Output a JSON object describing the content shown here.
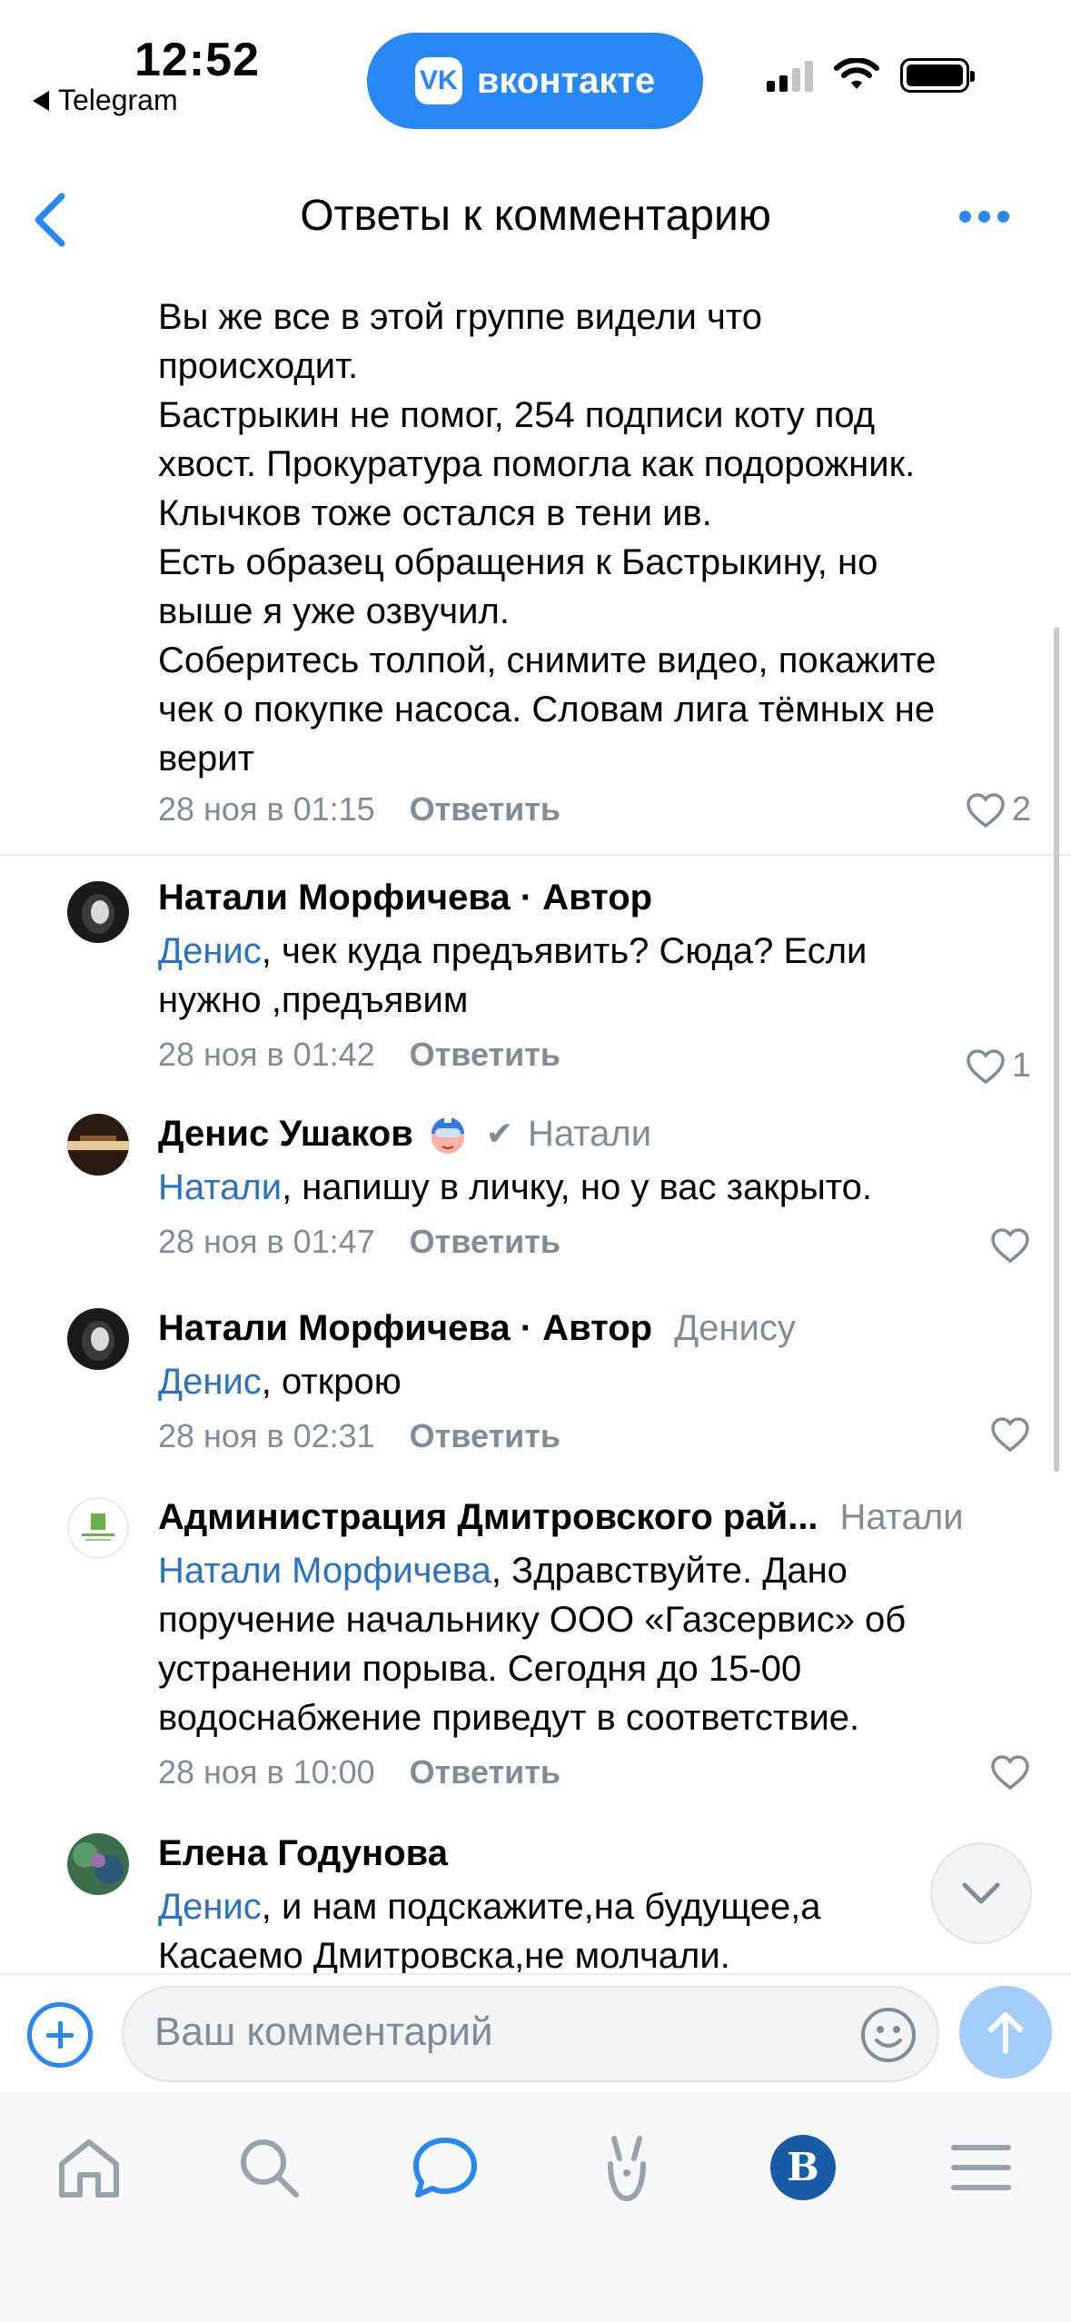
{
  "status_bar": {
    "time": "12:52",
    "back_app": "Telegram",
    "center_pill": "вконтакте",
    "vk_logo": "VK"
  },
  "header": {
    "title": "Ответы к комментарию",
    "back_icon": "chevron-left-icon",
    "more_icon": "more-horizontal-icon"
  },
  "first_comment": {
    "text_lines": [
      "Вы же все в этой группе видели что",
      "происходит.",
      "Бастрыкин не помог, 254 подписи коту под",
      "хвост. Прокуратура помогла как подорожник.",
      "Клычков тоже остался в тени ив.",
      "Есть образец обращения к Бастрыкину, но",
      "выше я уже озвучил.",
      "Соберитесь толпой, снимите видео, покажите",
      "чек о покупке насоса. Словам лига тёмных не",
      "верит"
    ],
    "date": "28 ноя в 01:15",
    "reply": "Ответить",
    "likes": "2"
  },
  "comments": [
    {
      "name": "Натали Морфичева · Автор",
      "to": "",
      "mention": "Денис",
      "text": ", чек куда предъявить? Сюда? Если",
      "text2": "нужно ,предъявим",
      "date": "28 ноя в 01:42",
      "reply": "Ответить",
      "likes": "1"
    },
    {
      "name": "Денис Ушаков",
      "to": "Натали",
      "mention": "Натали",
      "text": ", напишу в личку, но у вас закрыто.",
      "date": "28 ноя в 01:47",
      "reply": "Ответить",
      "likes": ""
    },
    {
      "name": "Натали Морфичева · Автор",
      "to": "Денису",
      "mention": "Денис",
      "text": ", открою",
      "date": "28 ноя в 02:31",
      "reply": "Ответить",
      "likes": ""
    },
    {
      "name": "Администрация Дмитровского рай...",
      "to": "Натали",
      "mention": "Натали Морфичева",
      "text": ", Здравствуйте. Дано",
      "text2": "поручение начальнику ООО «Газсервис» об",
      "text3": "устранении порыва. Сегодня до 15-00",
      "text4": "водоснабжение приведут в соответствие.",
      "date": "28 ноя в 10:00",
      "reply": "Ответить",
      "likes": ""
    },
    {
      "name": "Елена Годунова",
      "to": "",
      "mention": "Денис",
      "text": ", и нам подскажите,на будущее,а",
      "text2": "Касаемо Дмитровска,не молчали.",
      "date": "",
      "reply": "",
      "likes": ""
    }
  ],
  "composer": {
    "placeholder": "Ваш комментарий"
  },
  "tabbar": {
    "items": [
      "home-icon",
      "search-icon",
      "messages-icon",
      "clips-icon",
      "vk-services-icon",
      "menu-icon"
    ],
    "active": "messages-icon"
  },
  "colors": {
    "accent": "#2787f5",
    "mention": "#2a72c5",
    "secondary": "#818c99"
  }
}
